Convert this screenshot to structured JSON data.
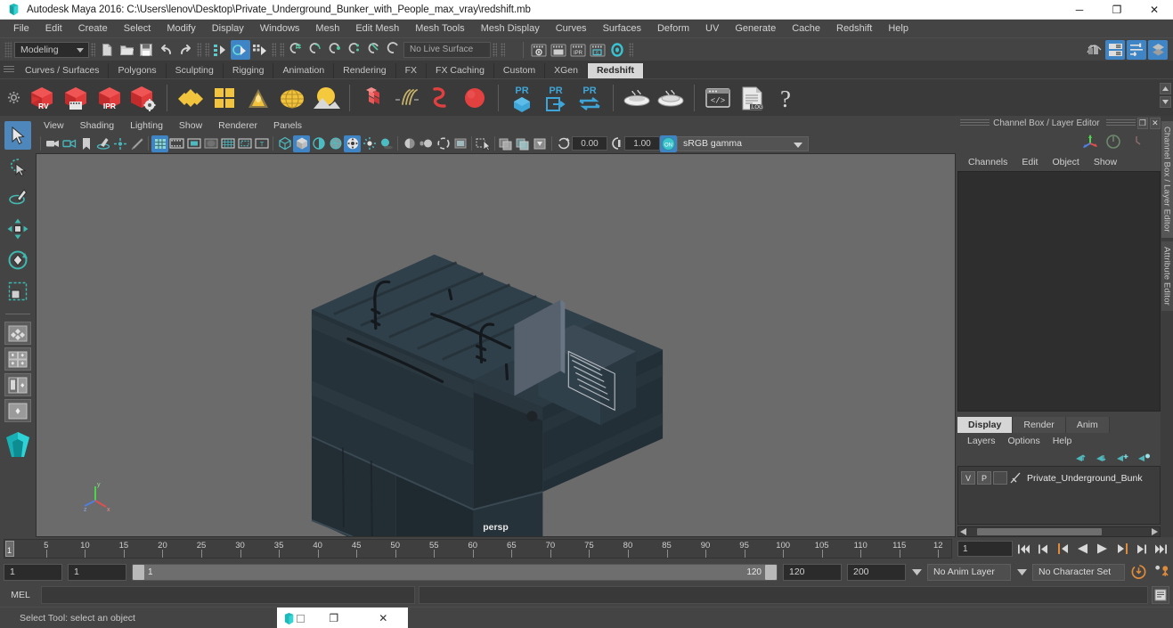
{
  "titlebar": {
    "title": "Autodesk Maya 2016: C:\\Users\\lenov\\Desktop\\Private_Underground_Bunker_with_People_max_vray\\redshift.mb",
    "app_icon": "maya-logo-icon",
    "minimize": "─",
    "maximize": "❐",
    "close": "✕"
  },
  "menubar": {
    "items": [
      {
        "label": "File"
      },
      {
        "label": "Edit"
      },
      {
        "label": "Create"
      },
      {
        "label": "Select"
      },
      {
        "label": "Modify"
      },
      {
        "label": "Display"
      },
      {
        "label": "Windows"
      },
      {
        "label": "Mesh"
      },
      {
        "label": "Edit Mesh"
      },
      {
        "label": "Mesh Tools"
      },
      {
        "label": "Mesh Display"
      },
      {
        "label": "Curves"
      },
      {
        "label": "Surfaces"
      },
      {
        "label": "Deform"
      },
      {
        "label": "UV"
      },
      {
        "label": "Generate"
      },
      {
        "label": "Cache"
      },
      {
        "label": "Redshift"
      },
      {
        "label": "Help"
      }
    ]
  },
  "statusline": {
    "menuset": "Modeling",
    "live_surface": "No Live Surface",
    "icons": [
      "new-scene-icon",
      "open-scene-icon",
      "save-scene-icon",
      "undo-icon",
      "redo-icon",
      "select-by-hierarchy-icon",
      "select-by-object-icon",
      "select-by-component-icon",
      "snap-to-grid-icon",
      "snap-to-curve-icon",
      "snap-to-point-icon",
      "snap-to-projected-center-icon",
      "snap-to-view-plane-icon",
      "make-live-icon"
    ],
    "right_icons": [
      "render-view-icon",
      "attribute-editor-icon",
      "tool-settings-icon",
      "channel-box-icon"
    ]
  },
  "shelf": {
    "tabs": [
      {
        "label": "Curves / Surfaces",
        "active": false
      },
      {
        "label": "Polygons",
        "active": false
      },
      {
        "label": "Sculpting",
        "active": false
      },
      {
        "label": "Rigging",
        "active": false
      },
      {
        "label": "Animation",
        "active": false
      },
      {
        "label": "Rendering",
        "active": false
      },
      {
        "label": "FX",
        "active": false
      },
      {
        "label": "FX Caching",
        "active": false
      },
      {
        "label": "Custom",
        "active": false
      },
      {
        "label": "XGen",
        "active": false
      },
      {
        "label": "Redshift",
        "active": true
      }
    ],
    "buttons": [
      {
        "name": "redshift-render-view-icon",
        "label": "RV"
      },
      {
        "name": "redshift-render-sequence-icon",
        "label": ""
      },
      {
        "name": "redshift-ipr-icon",
        "label": "IPR"
      },
      {
        "name": "redshift-render-settings-icon",
        "label": ""
      },
      {
        "name": "redshift-material-icon",
        "label": ""
      },
      {
        "name": "redshift-sub-surface-icon",
        "label": ""
      },
      {
        "name": "redshift-volume-icon",
        "label": ""
      },
      {
        "name": "redshift-dome-light-icon",
        "label": ""
      },
      {
        "name": "redshift-physical-sun-icon",
        "label": ""
      },
      {
        "name": "redshift-proxy-icon",
        "label": ""
      },
      {
        "name": "redshift-hair-icon",
        "label": ""
      },
      {
        "name": "redshift-curve-icon",
        "label": ""
      },
      {
        "name": "redshift-sphere-icon",
        "label": ""
      },
      {
        "name": "redshift-pr-object-icon",
        "label": "PR"
      },
      {
        "name": "redshift-pr-export-icon",
        "label": "PR"
      },
      {
        "name": "redshift-pr-transfer-icon",
        "label": "PR"
      },
      {
        "name": "redshift-bake-icon",
        "label": ""
      },
      {
        "name": "redshift-bake-all-icon",
        "label": ""
      },
      {
        "name": "redshift-script-icon",
        "label": ""
      },
      {
        "name": "redshift-log-icon",
        "label": ".LOG"
      },
      {
        "name": "redshift-help-icon",
        "label": "?"
      }
    ]
  },
  "toolbox": {
    "tools": [
      {
        "name": "select-tool",
        "selected": true
      },
      {
        "name": "lasso-select-tool",
        "selected": false
      },
      {
        "name": "paint-select-tool",
        "selected": false
      },
      {
        "name": "move-tool",
        "selected": false
      },
      {
        "name": "rotate-tool",
        "selected": false
      },
      {
        "name": "scale-tool",
        "selected": false
      }
    ],
    "layouts": [
      {
        "name": "layout-single-perspective"
      },
      {
        "name": "layout-four-view"
      },
      {
        "name": "layout-persp-outliner"
      },
      {
        "name": "layout-persp-graph"
      }
    ]
  },
  "viewport": {
    "menus": [
      {
        "label": "View"
      },
      {
        "label": "Shading"
      },
      {
        "label": "Lighting"
      },
      {
        "label": "Show"
      },
      {
        "label": "Renderer"
      },
      {
        "label": "Panels"
      }
    ],
    "camera_label": "persp",
    "exposure": "0.00",
    "gamma": "1.00",
    "color_management": "sRGB gamma",
    "background_color": "#6b6b6b",
    "model_color": "#2f3b42",
    "toolbar_icons": [
      "select-camera-icon",
      "camera-attributes-icon",
      "bookmark-icon",
      "image-plane-icon",
      "two-d-pan-zoom-icon",
      "grease-pencil-icon",
      "grid-toggle-icon",
      "film-gate-icon",
      "resolution-gate-icon",
      "gate-mask-icon",
      "field-chart-icon",
      "safe-action-icon",
      "safe-title-icon",
      "wireframe-icon",
      "smooth-shade-all-icon",
      "shade-selected-icon",
      "wireframe-on-shaded-icon",
      "texture-icon",
      "lights-icon",
      "shadows-icon",
      "screen-space-ao-icon",
      "motion-blur-icon",
      "multisample-icon",
      "depth-of-field-icon",
      "isolate-select-icon",
      "xray-icon",
      "xray-joints-icon",
      "xray-active-components-icon",
      "exposure-icon",
      "gamma-icon",
      "color-management-toggle-icon"
    ]
  },
  "channel_box": {
    "panel_title": "Channel Box / Layer Editor",
    "menus": [
      {
        "label": "Channels"
      },
      {
        "label": "Edit"
      },
      {
        "label": "Object"
      },
      {
        "label": "Show"
      }
    ],
    "tool_icons": [
      "manipulator-icon",
      "no-manipulator-icon",
      "channel-box-history-icon"
    ],
    "undock_icon": "❐",
    "close_icon": "✕"
  },
  "layer_editor": {
    "tabs": [
      {
        "label": "Display",
        "active": true
      },
      {
        "label": "Render",
        "active": false
      },
      {
        "label": "Anim",
        "active": false
      }
    ],
    "menus": [
      {
        "label": "Layers"
      },
      {
        "label": "Options"
      },
      {
        "label": "Help"
      }
    ],
    "tool_icons": [
      "move-layer-up-icon",
      "move-layer-down-icon",
      "new-layer-icon",
      "new-layer-from-selected-icon"
    ],
    "layers": [
      {
        "visibility": "V",
        "playback": "P",
        "color_swatch": "",
        "name": "Private_Underground_Bunk"
      }
    ]
  },
  "side_tabs": [
    {
      "label": "Channel Box / Layer Editor",
      "active": true
    },
    {
      "label": "Attribute Editor",
      "active": false
    }
  ],
  "timeline": {
    "current_frame": "1",
    "ticks": [
      {
        "value": "5",
        "pos": 5
      },
      {
        "value": "10",
        "pos": 10
      },
      {
        "value": "15",
        "pos": 15
      },
      {
        "value": "20",
        "pos": 20
      },
      {
        "value": "25",
        "pos": 25
      },
      {
        "value": "30",
        "pos": 30
      },
      {
        "value": "35",
        "pos": 35
      },
      {
        "value": "40",
        "pos": 40
      },
      {
        "value": "45",
        "pos": 45
      },
      {
        "value": "50",
        "pos": 50
      },
      {
        "value": "55",
        "pos": 55
      },
      {
        "value": "60",
        "pos": 60
      },
      {
        "value": "65",
        "pos": 65
      },
      {
        "value": "70",
        "pos": 70
      },
      {
        "value": "75",
        "pos": 75
      },
      {
        "value": "80",
        "pos": 80
      },
      {
        "value": "85",
        "pos": 85
      },
      {
        "value": "90",
        "pos": 90
      },
      {
        "value": "95",
        "pos": 95
      },
      {
        "value": "100",
        "pos": 100
      },
      {
        "value": "105",
        "pos": 105
      },
      {
        "value": "110",
        "pos": 110
      },
      {
        "value": "115",
        "pos": 115
      },
      {
        "value": "12",
        "pos": 120
      }
    ],
    "frame_field": "1",
    "playback_buttons": [
      "go-to-start-icon",
      "step-back-keyframe-icon",
      "step-back-frame-icon",
      "play-backwards-icon",
      "play-forwards-icon",
      "step-forward-frame-icon",
      "step-forward-keyframe-icon",
      "go-to-end-icon"
    ]
  },
  "range": {
    "start_field": "1",
    "playback_start_field": "1",
    "range_bar_start": "1",
    "range_bar_end": "120",
    "playback_end_field": "120",
    "end_field": "200",
    "anim_layer": "No Anim Layer",
    "character_set": "No Character Set",
    "auto_key_icon": "auto-keyframe-icon",
    "anim_prefs_icon": "animation-preferences-icon"
  },
  "mel": {
    "label": "MEL",
    "command_value": "",
    "output_value": "",
    "script_editor_icon": "script-editor-icon"
  },
  "statusbar": {
    "help_text": "Select Tool: select an object"
  },
  "taskwindow": {
    "icon": "maya-thumbnail-icon",
    "restore": "❐",
    "close": "✕"
  },
  "colors": {
    "accent_blue": "#3f84c4",
    "shelf_red": "#e03a3a",
    "shelf_yellow": "#f0c040",
    "teal": "#3fc0c8",
    "orange": "#e08030",
    "panel_bg": "#444444",
    "viewport_bg": "#6b6b6b"
  }
}
